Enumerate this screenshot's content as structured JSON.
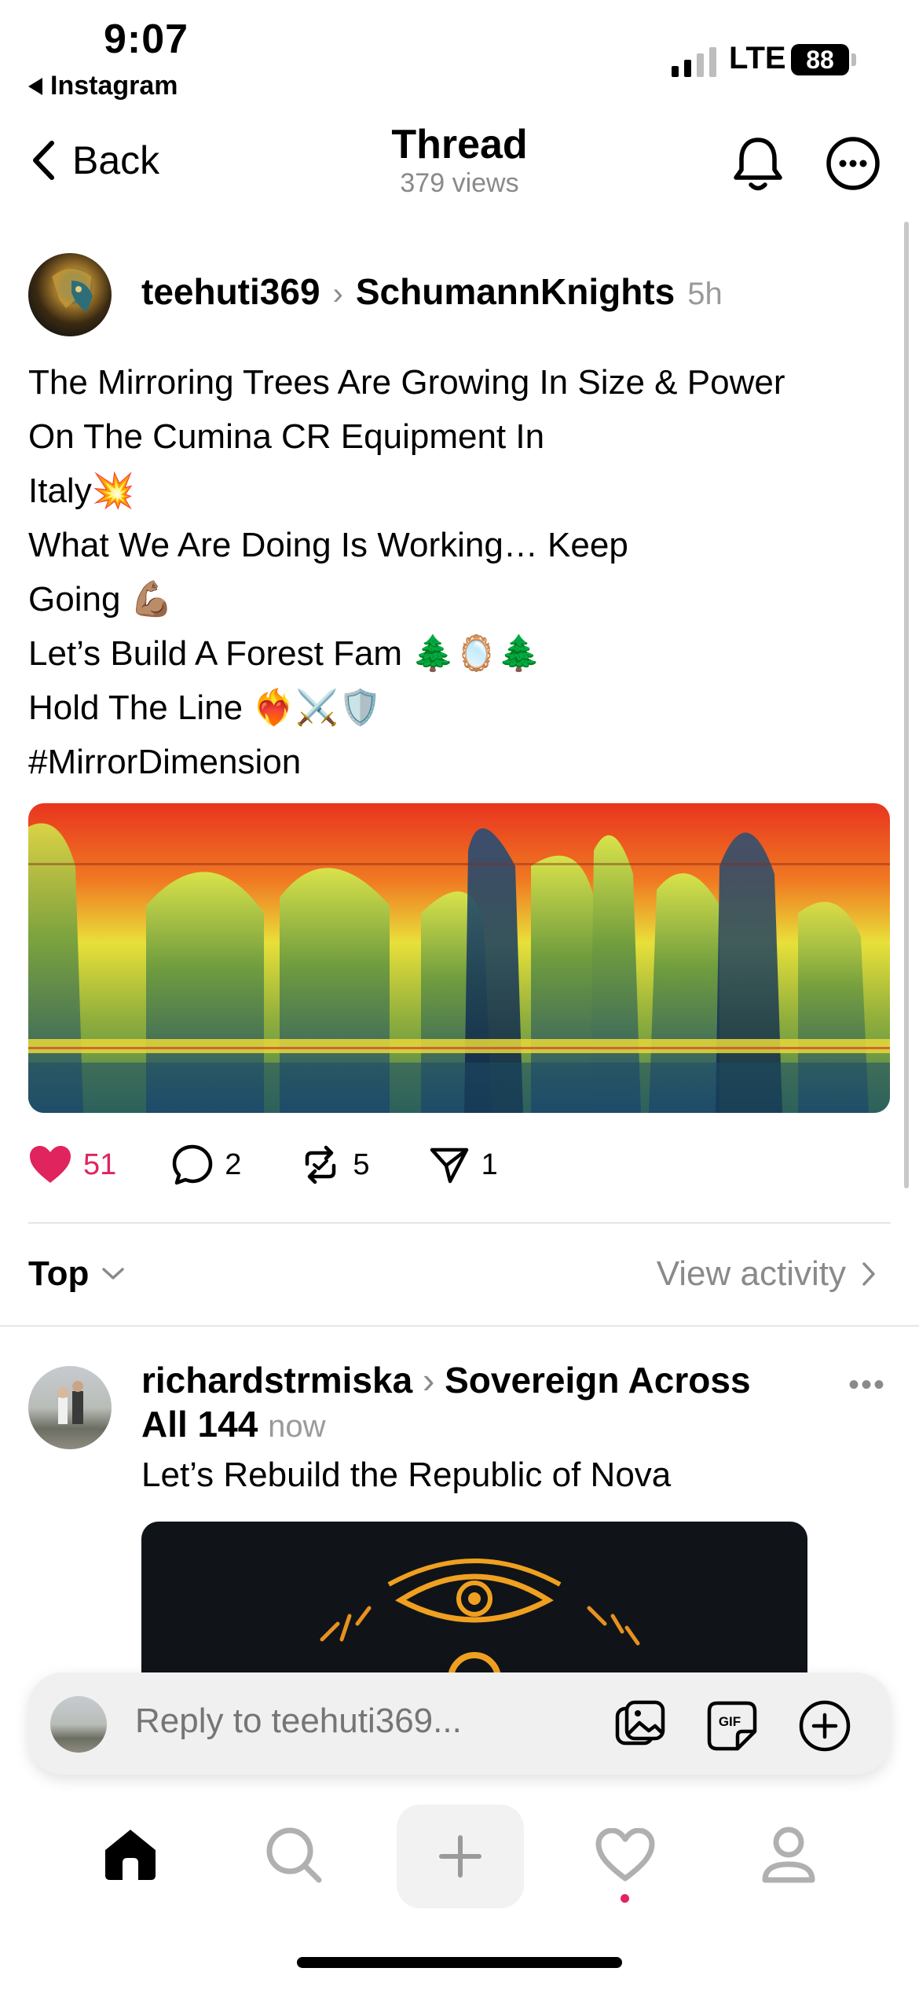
{
  "status_bar": {
    "time": "9:07",
    "back_app_label": "Instagram",
    "network": "LTE",
    "battery": "88"
  },
  "header": {
    "back_label": "Back",
    "title": "Thread",
    "views": "379 views"
  },
  "post": {
    "author": "teehuti369",
    "community": "SchumannKnights",
    "time_ago": "5h",
    "lines": [
      "The Mirroring Trees Are Growing In Size & Power",
      "On The Cumina CR Equipment In",
      "Italy💥",
      "What We Are Doing Is Working… Keep",
      "Going 💪🏽",
      "Let’s Build A Forest Fam 🌲🪞🌲",
      "Hold The Line ❤️‍🔥⚔️🛡️",
      "#MirrorDimension"
    ],
    "likes": "51",
    "comments": "2",
    "reposts": "5",
    "shares": "1",
    "liked": true
  },
  "sort": {
    "label": "Top",
    "view_activity": "View activity"
  },
  "reply": {
    "author": "richardstrmiska",
    "community": "Sovereign Across All 144",
    "community_part1": "Sovereign Across",
    "community_part2": "All 144",
    "time_ago": "now",
    "text": "Let’s Rebuild the Republic of Nova"
  },
  "composer": {
    "placeholder": "Reply to teehuti369..."
  },
  "icons": {
    "status": [
      "signal-icon",
      "battery-icon"
    ],
    "header": [
      "chevron-left-icon",
      "bell-icon",
      "more-horizontal-icon"
    ],
    "actions": [
      "heart-icon",
      "comment-icon",
      "repost-icon",
      "send-icon"
    ],
    "composer": [
      "gallery-icon",
      "gif-icon",
      "plus-circle-icon"
    ],
    "tabs": [
      "home-icon",
      "search-icon",
      "plus-icon",
      "heart-outline-icon",
      "profile-icon"
    ]
  },
  "colors": {
    "like": "#e0245e",
    "muted": "#8a8a8a"
  }
}
